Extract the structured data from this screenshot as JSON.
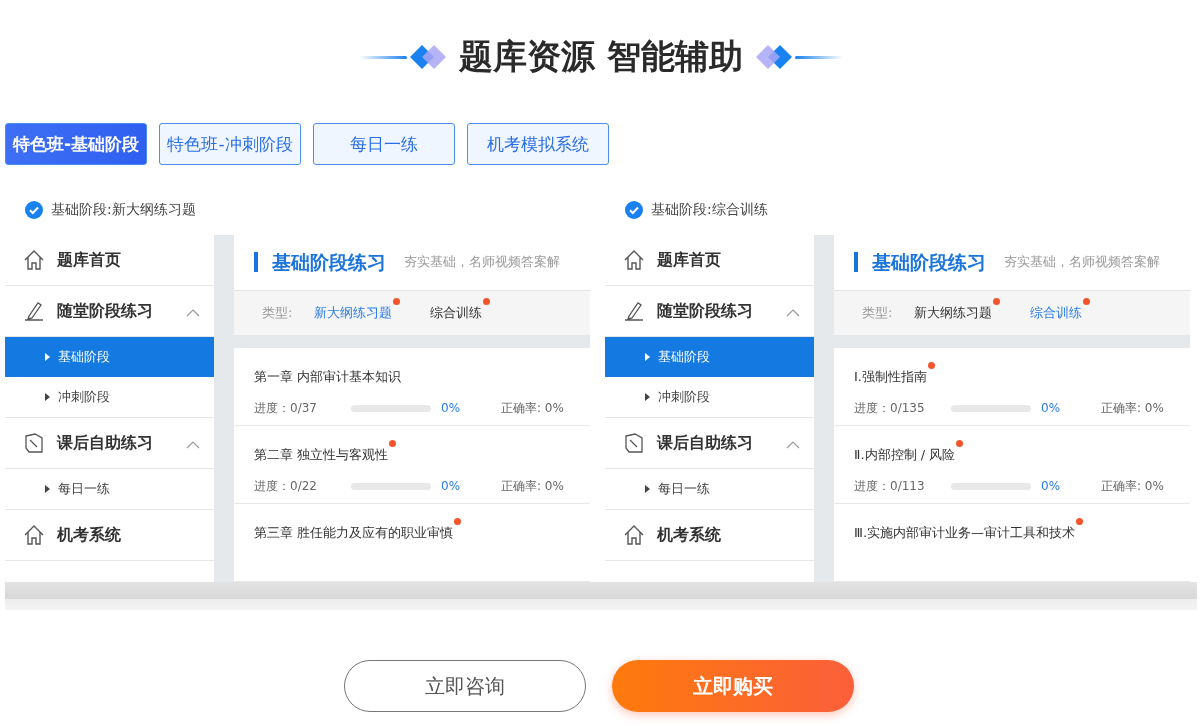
{
  "heading": "题库资源 智能辅助",
  "tabs": [
    {
      "label": "特色班-基础阶段",
      "selected": true
    },
    {
      "label": "特色班-冲刺阶段",
      "selected": false
    },
    {
      "label": "每日一练",
      "selected": false
    },
    {
      "label": "机考模拟系统",
      "selected": false
    }
  ],
  "panels": [
    {
      "caption": "基础阶段:新大纲练习题",
      "checked": true,
      "sidebar": [
        {
          "kind": "home",
          "label": "题库首页"
        },
        {
          "kind": "pencil",
          "label": "随堂阶段练习",
          "expanded": true,
          "children": [
            {
              "label": "基础阶段",
              "selected": true
            },
            {
              "label": "冲刺阶段",
              "selected": false
            }
          ]
        },
        {
          "kind": "notebook",
          "label": "课后自助练习",
          "expanded": true,
          "children": [
            {
              "label": "每日一练",
              "selected": false
            }
          ]
        },
        {
          "kind": "home",
          "label": "机考系统"
        }
      ],
      "title": "基础阶段练习",
      "subtitle": "夯实基础，名师视频答案解",
      "filter_label": "类型:",
      "filters": [
        {
          "label": "新大纲练习题",
          "selected": true,
          "dot": true
        },
        {
          "label": "综合训练",
          "selected": false,
          "dot": true
        }
      ],
      "items": [
        {
          "title": "第一章 内部审计基本知识",
          "dot": false,
          "progress": "进度：0/37",
          "level": 0,
          "percent": "0%",
          "accuracy": "正确率: 0%"
        },
        {
          "title": "第二章 独立性与客观性",
          "dot": true,
          "progress": "进度：0/22",
          "level": 0,
          "percent": "0%",
          "accuracy": "正确率: 0%"
        },
        {
          "title": "第三章 胜任能力及应有的职业审慎",
          "dot": true
        }
      ]
    },
    {
      "caption": "基础阶段:综合训练",
      "checked": true,
      "sidebar": [
        {
          "kind": "home",
          "label": "题库首页"
        },
        {
          "kind": "pencil",
          "label": "随堂阶段练习",
          "expanded": true,
          "children": [
            {
              "label": "基础阶段",
              "selected": true
            },
            {
              "label": "冲刺阶段",
              "selected": false
            }
          ]
        },
        {
          "kind": "notebook",
          "label": "课后自助练习",
          "expanded": true,
          "children": [
            {
              "label": "每日一练",
              "selected": false
            }
          ]
        },
        {
          "kind": "home",
          "label": "机考系统"
        }
      ],
      "title": "基础阶段练习",
      "subtitle": "夯实基础，名师视频答案解",
      "filter_label": "类型:",
      "filters": [
        {
          "label": "新大纲练习题",
          "selected": false,
          "dot": true
        },
        {
          "label": "综合训练",
          "selected": true,
          "dot": true
        }
      ],
      "items": [
        {
          "title": "Ⅰ.强制性指南",
          "dot": true,
          "progress": "进度：0/135",
          "level": 0,
          "percent": "0%",
          "accuracy": "正确率: 0%"
        },
        {
          "title": "Ⅱ.内部控制 / 风险",
          "dot": true,
          "progress": "进度：0/113",
          "level": 0,
          "percent": "0%",
          "accuracy": "正确率: 0%"
        },
        {
          "title": "Ⅲ.实施内部审计业务—审计工具和技术",
          "dot": true
        }
      ]
    }
  ],
  "buttons": [
    {
      "kind": "outline",
      "label": "立即咨询"
    },
    {
      "kind": "primary",
      "label": "立即购买"
    }
  ]
}
